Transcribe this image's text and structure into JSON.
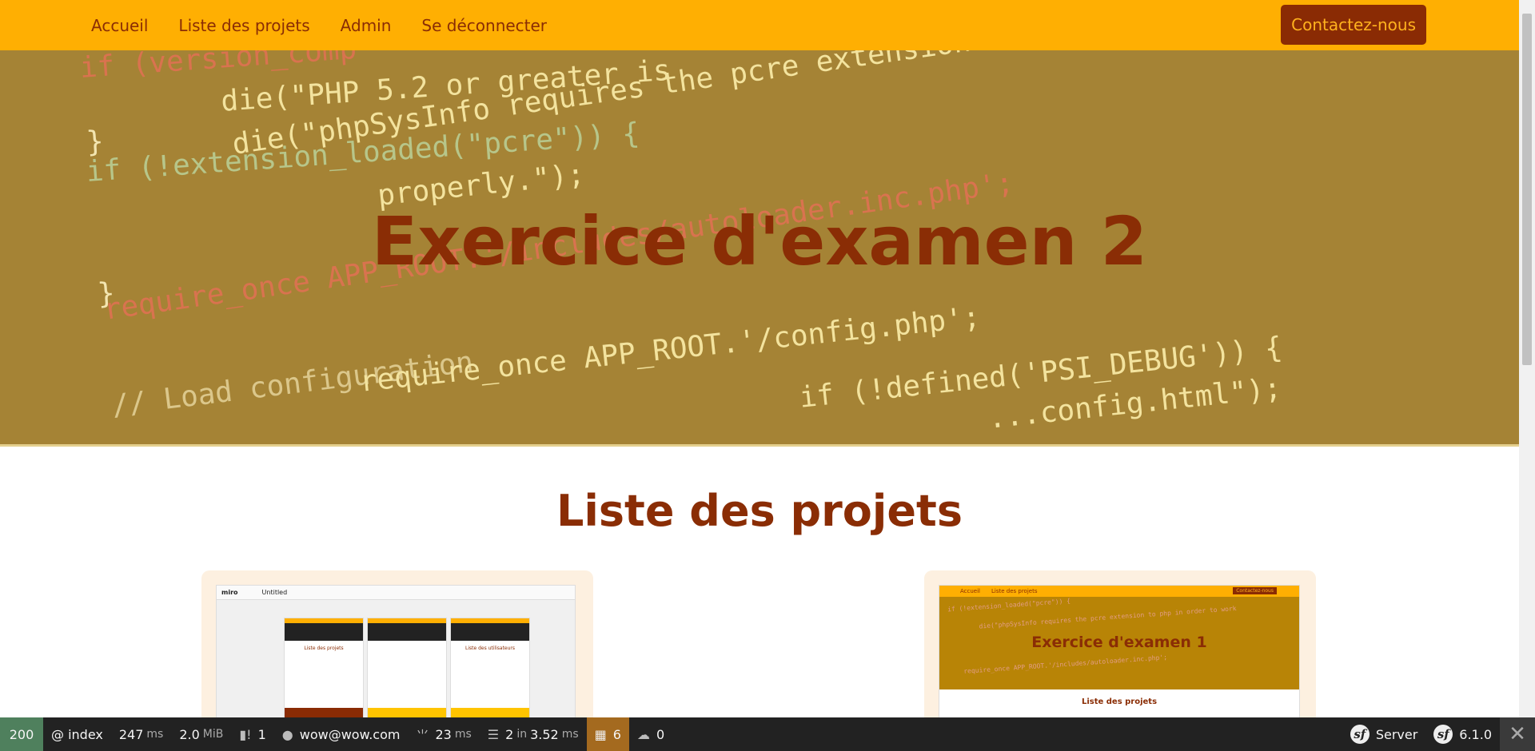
{
  "nav": {
    "links": [
      "Accueil",
      "Liste des projets",
      "Admin",
      "Se déconnecter"
    ],
    "contact_label": "Contactez-nous"
  },
  "hero": {
    "title": "Exercice d'examen 2",
    "code_lines": [
      "if (version_comp",
      "    die(\"PHP 5.2 or greater is",
      "}",
      "if (!extension_loaded(\"pcre\")) {",
      "    die(\"phpSysInfo requires the pcre extension to php in order to work",
      "        properly.\");",
      "}",
      "require_once APP_ROOT.'/includes/autoloader.inc.php';",
      "// Load configuration",
      "require_once APP_ROOT.'/config.php';",
      "if (!defined('PSI_DEBUG')) {",
      "    ...config.html\");"
    ]
  },
  "main": {
    "section_title": "Liste des projets",
    "cards": [
      {
        "preview": {
          "app_name": "miro",
          "board_name": "Untitled",
          "frames": [
            "Liste des projets",
            "Liste des utilisateurs"
          ]
        }
      },
      {
        "preview": {
          "nav_links": [
            "Accueil",
            "Liste des projets"
          ],
          "contact_label": "Contactez-nous",
          "title": "Exercice d'examen 1",
          "section_title": "Liste des projets"
        }
      }
    ]
  },
  "toolbar": {
    "status": "200",
    "route": "@ index",
    "time_value": "247",
    "time_unit": "ms",
    "memory_value": "2.0",
    "memory_unit": "MiB",
    "logs_count": "1",
    "user": "wow@wow.com",
    "twig_value": "23",
    "twig_unit": "ms",
    "db_value": "2",
    "db_in": "in",
    "db_time": "3.52",
    "db_unit": "ms",
    "forms_count": "6",
    "http_count": "0",
    "server_label": "Server",
    "symfony_version": "6.1.0"
  },
  "colors": {
    "navbar": "#ffaf02",
    "brand_dark": "#8a2d05",
    "hero_overlay": "#a58335",
    "toolbar_bg": "#222222",
    "status_ok": "#4f805d"
  }
}
